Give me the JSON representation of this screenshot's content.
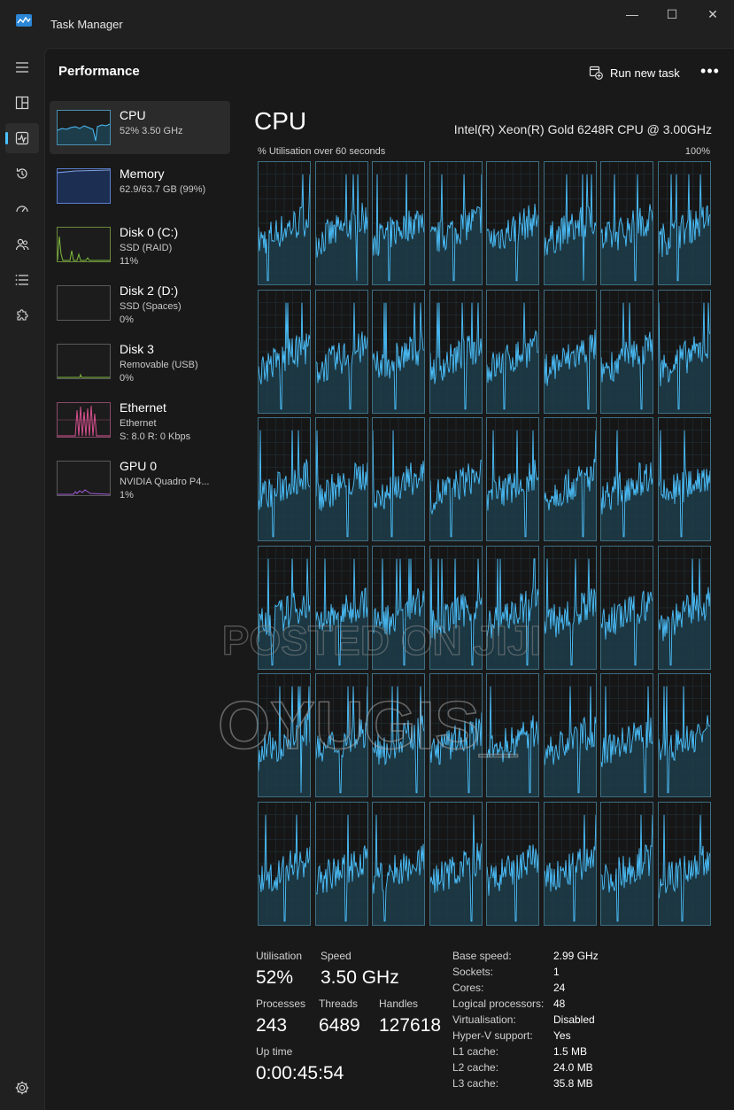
{
  "window": {
    "title": "Task Manager"
  },
  "header": {
    "page_title": "Performance",
    "run_task_label": "Run new task",
    "more_label": "•••"
  },
  "resources": [
    {
      "name": "CPU",
      "sub1": "52%  3.50 GHz",
      "sub2": ""
    },
    {
      "name": "Memory",
      "sub1": "62.9/63.7 GB (99%)",
      "sub2": ""
    },
    {
      "name": "Disk 0 (C:)",
      "sub1": "SSD (RAID)",
      "sub2": "11%"
    },
    {
      "name": "Disk 2 (D:)",
      "sub1": "SSD (Spaces)",
      "sub2": "0%"
    },
    {
      "name": "Disk 3",
      "sub1": "Removable (USB)",
      "sub2": "0%"
    },
    {
      "name": "Ethernet",
      "sub1": "Ethernet",
      "sub2": "S: 8.0  R: 0 Kbps"
    },
    {
      "name": "GPU 0",
      "sub1": "NVIDIA Quadro P4...",
      "sub2": "1%"
    }
  ],
  "main": {
    "title": "CPU",
    "model": "Intel(R) Xeon(R) Gold 6248R CPU @ 3.00GHz",
    "graph_label": "% Utilisation over 60 seconds",
    "graph_max": "100%",
    "logical_processor_count": 48
  },
  "stats": {
    "utilisation_label": "Utilisation",
    "utilisation": "52%",
    "speed_label": "Speed",
    "speed": "3.50 GHz",
    "processes_label": "Processes",
    "processes": "243",
    "threads_label": "Threads",
    "threads": "6489",
    "handles_label": "Handles",
    "handles": "127618",
    "uptime_label": "Up time",
    "uptime": "0:00:45:54"
  },
  "specs": [
    {
      "key": "Base speed:",
      "value": "2.99 GHz"
    },
    {
      "key": "Sockets:",
      "value": "1"
    },
    {
      "key": "Cores:",
      "value": "24"
    },
    {
      "key": "Logical processors:",
      "value": "48"
    },
    {
      "key": "Virtualisation:",
      "value": "Disabled"
    },
    {
      "key": "Hyper-V support:",
      "value": "Yes"
    },
    {
      "key": "L1 cache:",
      "value": "1.5 MB"
    },
    {
      "key": "L2 cache:",
      "value": "24.0 MB"
    },
    {
      "key": "L3 cache:",
      "value": "35.8 MB"
    }
  ],
  "colors": {
    "cpu_line": "#4cc2ff",
    "cpu_fill": "#1d3d4a",
    "memory_line": "#5b7fd1",
    "disk_line": "#7dbb3d",
    "ethernet_line": "#d9508f",
    "gpu_line": "#a35ad8",
    "accent": "#4cc2ff"
  },
  "watermark": [
    "POSTED ON JIJI",
    "OYUGIS_"
  ]
}
